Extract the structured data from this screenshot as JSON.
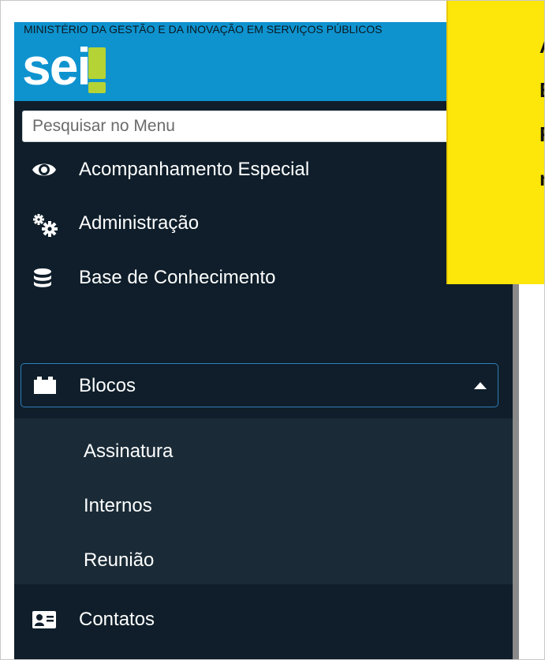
{
  "header": {
    "ministry": "MINISTÉRIO DA GESTÃO E DA INOVAÇÃO EM SERVIÇOS PÚBLICOS",
    "logo_text": "sei",
    "logo_mark": "!"
  },
  "search": {
    "placeholder": "Pesquisar no Menu"
  },
  "menu": {
    "items": [
      {
        "label": "Acompanhamento Especial",
        "icon": "eye-icon"
      },
      {
        "label": "Administração",
        "icon": "gears-icon"
      },
      {
        "label": "Base de Conhecimento",
        "icon": "database-icon"
      },
      {
        "label": "Blocos",
        "icon": "blocks-icon",
        "expanded": true
      },
      {
        "label": "Contatos",
        "icon": "contact-card-icon"
      }
    ],
    "blocos_sub": [
      "Assinatura",
      "Internos",
      "Reunião"
    ]
  },
  "callout": {
    "lines": [
      "A",
      "E",
      "R",
      "n"
    ]
  },
  "colors": {
    "header_blue": "#0e93cf",
    "sidebar_bg": "#0f1e2a",
    "submenu_bg": "#1a2b37",
    "callout_yellow": "#fde60a",
    "logo_green": "#b5d335"
  }
}
